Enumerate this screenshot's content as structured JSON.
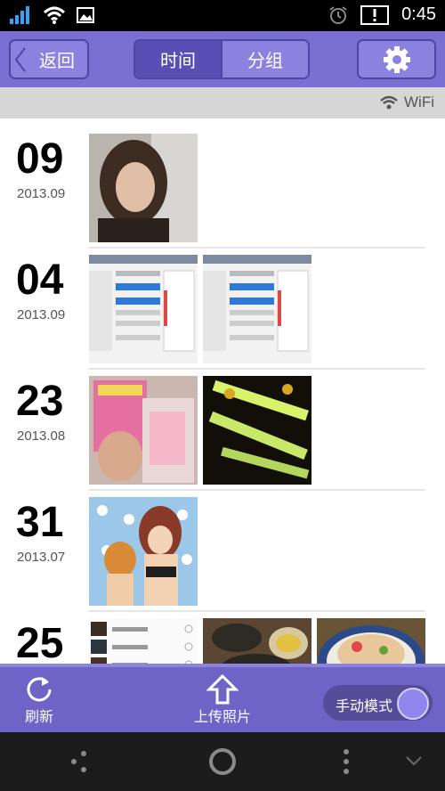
{
  "status_bar": {
    "time": "0:45",
    "icons": [
      "signal-icon",
      "wifi-icon",
      "image-notification-icon",
      "alarm-icon",
      "alert-icon"
    ]
  },
  "header": {
    "back_label": "返回",
    "tabs": [
      {
        "label": "时间",
        "active": true
      },
      {
        "label": "分组",
        "active": false
      }
    ],
    "settings_icon": "gear-icon"
  },
  "connection": {
    "label": "WiFi"
  },
  "groups": [
    {
      "day": "09",
      "month": "2013.09",
      "photos": 1
    },
    {
      "day": "04",
      "month": "2013.09",
      "photos": 2
    },
    {
      "day": "23",
      "month": "2013.08",
      "photos": 2
    },
    {
      "day": "31",
      "month": "2013.07",
      "photos": 1
    },
    {
      "day": "25",
      "month": "",
      "photos": 3
    }
  ],
  "bottom_bar": {
    "refresh_label": "刷新",
    "upload_label": "上传照片",
    "mode_label": "手动模式"
  },
  "colors": {
    "accent": "#7a6fd2",
    "accent_dark": "#574fb4",
    "bottom_bar": "#6e63c7"
  }
}
